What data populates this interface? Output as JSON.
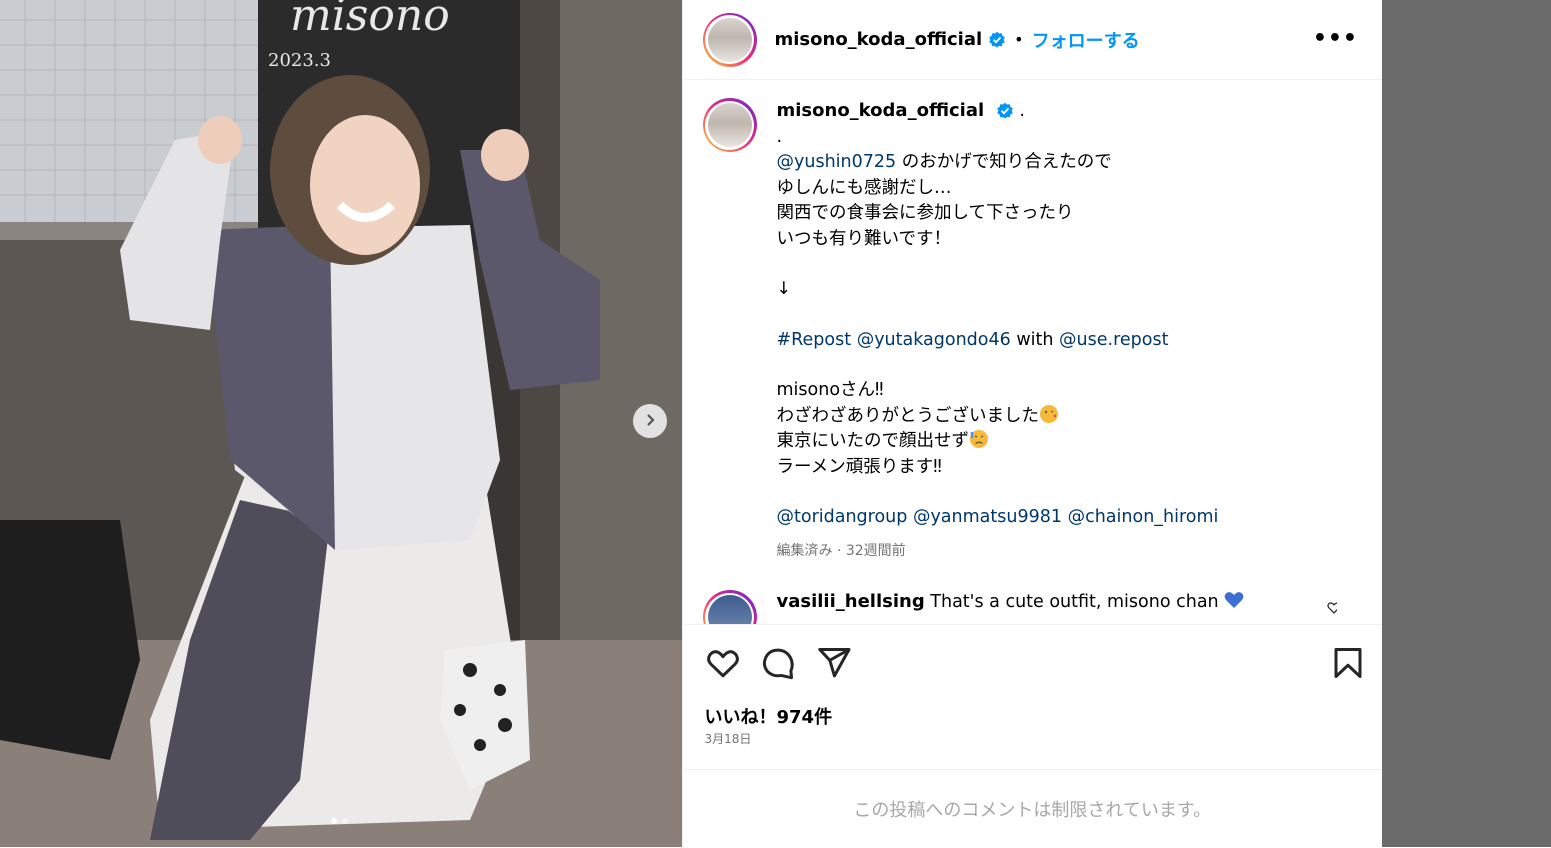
{
  "post": {
    "username": "misono_koda_official",
    "dot": "•",
    "follow_label": "フォローする",
    "more_label": "•••"
  },
  "caption": {
    "username": "misono_koda_official",
    "after_name": ".",
    "line_dot": ".",
    "mention1": "@yushin0725",
    "line1_rest": " のおかげで知り合えたので",
    "line2": "ゆしんにも感謝だし…",
    "line3": "関西での食事会に参加して下さったり",
    "line4": "いつも有り難いです！",
    "arrow": "↓",
    "hashtag": "#Repost",
    "mention2": "@yutakagondo46",
    "with_word": " with ",
    "mention3": "@use.repost",
    "line5": "misonoさん‼︎",
    "line6": "わざわざありがとうございました",
    "line7": "東京にいたので顔出せず",
    "line8": "ラーメン頑張ります‼︎",
    "mention4": "@toridangroup",
    "mention5": "@yanmatsu9981",
    "mention6": "@chainon_hiromi",
    "meta": "編集済み · 32週間前"
  },
  "comment": {
    "username": "vasilii_hellsing",
    "text": "That's a cute outfit, misono chan"
  },
  "likes": "いいね！974件",
  "date": "3月18日",
  "comments_limited": "この投稿へのコメントは制限されています。",
  "photo": {
    "sign_top": "misono",
    "sign_year": "2023.3"
  },
  "icons": [
    "verified-badge-icon",
    "more-icon",
    "heart-icon",
    "comment-icon",
    "share-icon",
    "bookmark-icon",
    "chevron-right-icon",
    "small-heart-icon",
    "blue-heart-emoji",
    "kiss-emoji",
    "sad-emoji"
  ],
  "colors": {
    "accent": "#0095f6",
    "link": "#00376b",
    "muted": "#737373"
  }
}
